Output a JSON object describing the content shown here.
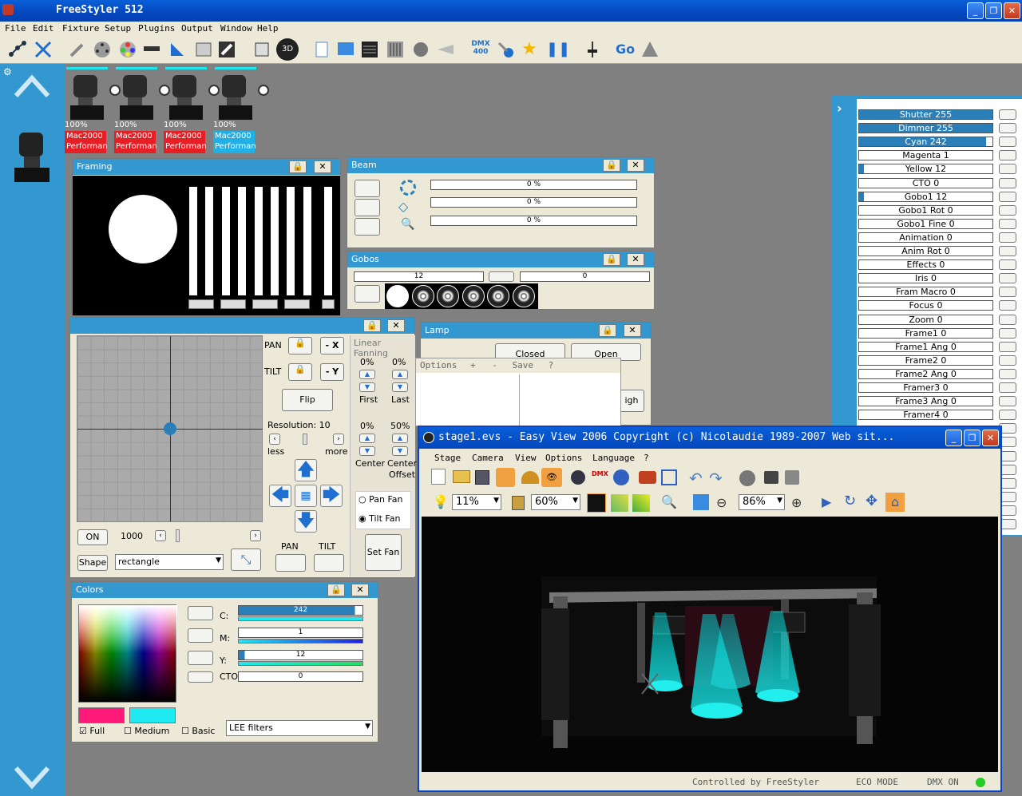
{
  "app": {
    "title": "FreeStyler 512"
  },
  "menu": [
    "File",
    "Edit",
    "Fixture",
    "Setup",
    "Plugins",
    "Output",
    "Window",
    "Help"
  ],
  "toolbar": {
    "dmx_label": "DMX\n400",
    "go_label": "Go"
  },
  "fixtures": [
    {
      "pct": "100%",
      "name": "Mac2000 Performan",
      "color": "#e81e25"
    },
    {
      "pct": "100%",
      "name": "Mac2000 Performan",
      "color": "#e81e25"
    },
    {
      "pct": "100%",
      "name": "Mac2000 Performan",
      "color": "#e81e25"
    },
    {
      "pct": "100%",
      "name": "Mac2000 Performan",
      "color": "#1fb0e8"
    }
  ],
  "framing": {
    "title": "Framing"
  },
  "beam": {
    "title": "Beam",
    "bars": [
      "0 %",
      "0 %",
      "0 %"
    ]
  },
  "gobos": {
    "title": "Gobos",
    "value1": "12",
    "value2": "0"
  },
  "lamp": {
    "title": "Lamp",
    "closed": "Closed",
    "open": "Open",
    "high": "igh"
  },
  "options_menu": {
    "label": "Options",
    "plus": "+",
    "minus": "-",
    "save": "Save",
    "help": "?"
  },
  "pantilt": {
    "pan": "PAN",
    "tilt": "TILT",
    "minus_x": "- X",
    "minus_y": "- Y",
    "flip": "Flip",
    "resolution": "Resolution: 10",
    "less": "less",
    "more": "more",
    "on": "ON",
    "speed": "1000",
    "shape_btn": "Shape",
    "shape_value": "rectangle",
    "pan2": "PAN",
    "tilt2": "TILT"
  },
  "fanning": {
    "title": "Linear Fanning",
    "first_pct": "0%",
    "last_pct": "0%",
    "first": "First",
    "last": "Last",
    "center_pct": "0%",
    "offset_pct": "50%",
    "center": "Center",
    "center_offset": "Center\nOffset",
    "pan_fan": "Pan Fan",
    "tilt_fan": "Tilt Fan",
    "set_fan": "Set Fan"
  },
  "colors": {
    "title": "Colors",
    "c_label": "C:",
    "c_val": "242",
    "m_label": "M:",
    "m_val": "1",
    "y_label": "Y:",
    "y_val": "12",
    "cto_label": "CTO",
    "cto_val": "0",
    "full": "Full",
    "medium": "Medium",
    "basic": "Basic",
    "filter": "LEE filters",
    "swatch1": "#ff1a7a",
    "swatch2": "#1ee8f0"
  },
  "channels": [
    {
      "label": "Shutter",
      "value": "255",
      "fill": 1.0
    },
    {
      "label": "Dimmer",
      "value": "255",
      "fill": 1.0
    },
    {
      "label": "Cyan",
      "value": "242",
      "fill": 0.95
    },
    {
      "label": "Magenta",
      "value": "1",
      "fill": 0.0
    },
    {
      "label": "Yellow",
      "value": "12",
      "fill": 0.05
    },
    {
      "label": "CTO",
      "value": "0",
      "fill": 0.0
    },
    {
      "label": "Gobo1",
      "value": "12",
      "fill": 0.05
    },
    {
      "label": "Gobo1 Rot",
      "value": "0",
      "fill": 0.0
    },
    {
      "label": "Gobo1 Fine",
      "value": "0",
      "fill": 0.0
    },
    {
      "label": "Animation",
      "value": "0",
      "fill": 0.0
    },
    {
      "label": "Anim Rot",
      "value": "0",
      "fill": 0.0
    },
    {
      "label": "Effects",
      "value": "0",
      "fill": 0.0
    },
    {
      "label": "Iris",
      "value": "0",
      "fill": 0.0
    },
    {
      "label": "Fram Macro",
      "value": "0",
      "fill": 0.0
    },
    {
      "label": "Focus",
      "value": "0",
      "fill": 0.0
    },
    {
      "label": "Zoom",
      "value": "0",
      "fill": 0.0
    },
    {
      "label": "Frame1",
      "value": "0",
      "fill": 0.0
    },
    {
      "label": "Frame1 Ang",
      "value": "0",
      "fill": 0.0
    },
    {
      "label": "Frame2",
      "value": "0",
      "fill": 0.0
    },
    {
      "label": "Frame2 Ang",
      "value": "0",
      "fill": 0.0
    },
    {
      "label": "Framer3",
      "value": "0",
      "fill": 0.0
    },
    {
      "label": "Frame3 Ang",
      "value": "0",
      "fill": 0.0
    },
    {
      "label": "Framer4",
      "value": "0",
      "fill": 0.0
    }
  ],
  "easyview": {
    "title": "stage1.evs - Easy View 2006   Copyright (c) Nicolaudie 1989-2007   Web sit...",
    "menu": [
      "Stage",
      "Camera",
      "View",
      "Options",
      "Language",
      "?"
    ],
    "zoom1": "11%",
    "zoom2": "60%",
    "zoom3": "86%",
    "status1": "Controlled by FreeStyler",
    "status2": "ECO MODE",
    "status3": "DMX ON"
  }
}
